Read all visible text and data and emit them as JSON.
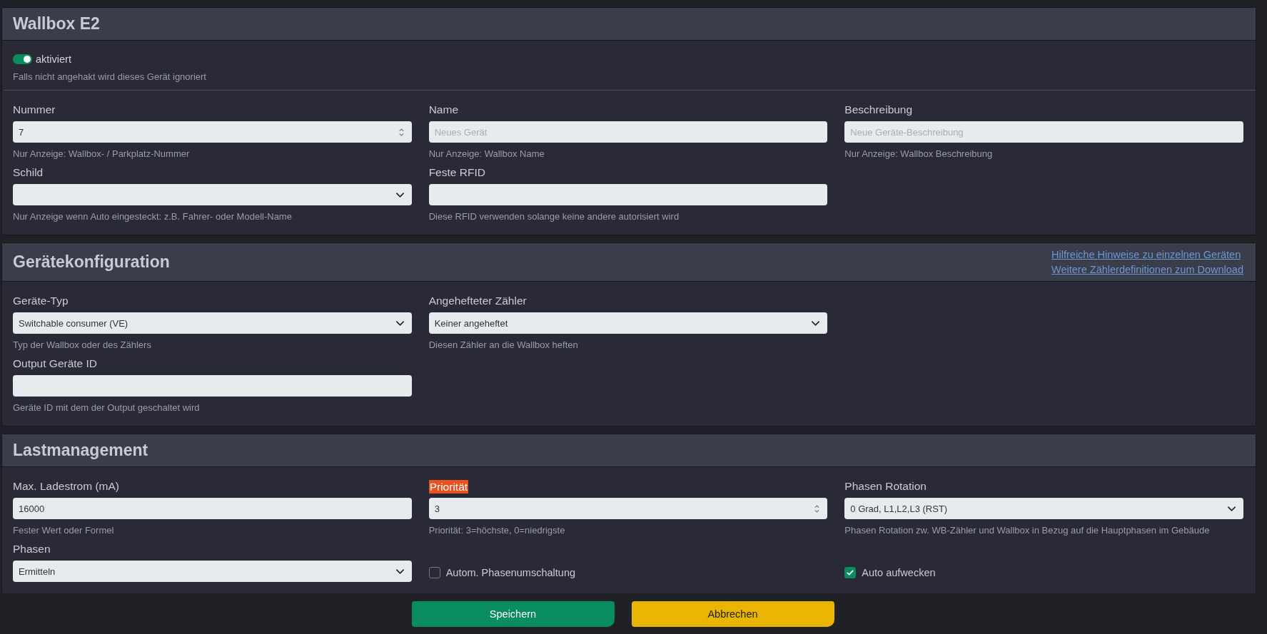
{
  "sections": [
    {
      "title": "Wallbox E2",
      "toggle": {
        "label": "aktiviert",
        "on": true,
        "help": "Falls nicht angehakt wird dieses Gerät ignoriert"
      },
      "rows": [
        [
          {
            "kind": "number",
            "label": "Nummer",
            "value": "7",
            "help": "Nur Anzeige: Wallbox- / Parkplatz-Nummer"
          },
          {
            "kind": "text",
            "label": "Name",
            "placeholder": "Neues Gerät",
            "help": "Nur Anzeige: Wallbox Name"
          },
          {
            "kind": "text",
            "label": "Beschreibung",
            "placeholder": "Neue Geräte-Beschreibung",
            "help": "Nur Anzeige: Wallbox Beschreibung"
          }
        ],
        [
          {
            "kind": "select",
            "label": "Schild",
            "help": "Nur Anzeige wenn Auto eingesteckt: z.B. Fahrer- oder Modell-Name"
          },
          {
            "kind": "text",
            "label": "Feste RFID",
            "help": "Diese RFID verwenden solange keine andere autorisiert wird"
          }
        ]
      ]
    },
    {
      "title": "Gerätekonfiguration",
      "links": [
        "Hilfreiche Hinweise zu einzelnen Geräten",
        "Weitere Zählerdefinitionen zum Download"
      ],
      "rows": [
        [
          {
            "kind": "select",
            "label": "Geräte-Typ",
            "value": "Switchable consumer (VE)",
            "help": "Typ der Wallbox oder des Zählers"
          },
          {
            "kind": "select",
            "label": "Angehefteter Zähler",
            "value": "Keiner angeheftet",
            "help": "Diesen Zähler an die Wallbox heften"
          }
        ],
        [
          {
            "kind": "text",
            "label": "Output Geräte ID",
            "help": "Geräte ID mit dem der Output geschaltet wird"
          }
        ]
      ]
    },
    {
      "title": "Lastmanagement",
      "rows": [
        [
          {
            "kind": "text",
            "label": "Max. Ladestrom (mA)",
            "value": "16000",
            "help": "Fester Wert oder Formel"
          },
          {
            "kind": "number",
            "label": "Priorität",
            "highlighted": true,
            "value": "3",
            "help": "Priorität: 3=höchste, 0=niedrigste"
          },
          {
            "kind": "select",
            "label": "Phasen Rotation",
            "value": "0 Grad, L1,L2,L3 (RST)",
            "help": "Phasen Rotation zw. WB-Zähler und Wallbox in Bezug auf die Hauptphasen im Gebäude"
          }
        ],
        [
          {
            "kind": "select",
            "label": "Phasen",
            "value": "Ermitteln"
          },
          {
            "kind": "checkbox",
            "label": "Autom. Phasenumschaltung",
            "checked": false
          },
          {
            "kind": "checkbox",
            "label": "Auto aufwecken",
            "checked": true
          }
        ]
      ]
    }
  ],
  "buttons": [
    {
      "kind": "primary",
      "label": "Speichern"
    },
    {
      "kind": "warning",
      "label": "Abbrechen"
    }
  ]
}
